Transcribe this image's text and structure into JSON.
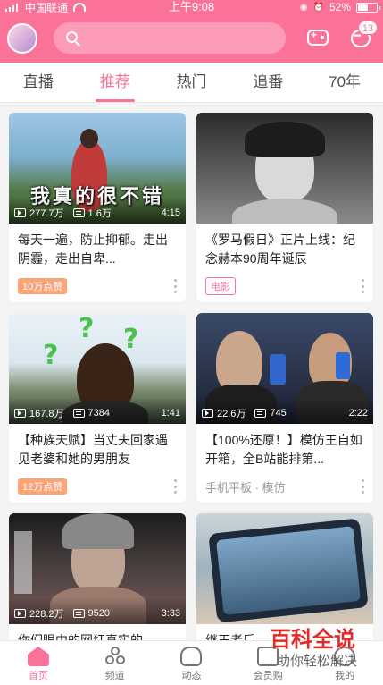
{
  "status_bar": {
    "carrier": "中国联通",
    "time": "上午9:08",
    "battery": "52%"
  },
  "header": {
    "search_placeholder": "",
    "message_badge": "13"
  },
  "tabs": [
    {
      "label": "直播",
      "active": false
    },
    {
      "label": "推荐",
      "active": true
    },
    {
      "label": "热门",
      "active": false
    },
    {
      "label": "追番",
      "active": false
    },
    {
      "label": "70年",
      "active": false
    }
  ],
  "cards": [
    {
      "overlay": "我真的很不错",
      "views": "277.7万",
      "danmaku": "1.6万",
      "duration": "4:15",
      "title": "每天一遍，防止抑郁。走出阴霾，走出自卑...",
      "tag": "10万点赞",
      "tag_style": "fill",
      "meta": ""
    },
    {
      "overlay": "",
      "views": "",
      "danmaku": "",
      "duration": "",
      "title": "《罗马假日》正片上线：纪念赫本90周年诞辰",
      "tag": "电影",
      "tag_style": "line",
      "meta": ""
    },
    {
      "overlay": "",
      "views": "167.8万",
      "danmaku": "7384",
      "duration": "1:41",
      "title": "【种族天赋】当丈夫回家遇见老婆和她的男朋友",
      "tag": "12万点赞",
      "tag_style": "fill",
      "meta": ""
    },
    {
      "overlay": "",
      "views": "22.6万",
      "danmaku": "745",
      "duration": "2:22",
      "title": "【100%还原！】模仿王自如开箱，全B站能排第...",
      "tag": "",
      "tag_style": "",
      "meta": "手机平板 · 模仿"
    },
    {
      "overlay": "",
      "views": "228.2万",
      "danmaku": "9520",
      "duration": "3:33",
      "title": "你们眼中的网红真实的...",
      "tag": "",
      "tag_style": "",
      "meta": ""
    },
    {
      "overlay": "",
      "views": "",
      "danmaku": "",
      "duration": "",
      "title": "继王者后...",
      "tag": "",
      "tag_style": "",
      "meta": ""
    }
  ],
  "bottom_nav": [
    {
      "label": "首页",
      "icon": "home-icon",
      "active": true
    },
    {
      "label": "频道",
      "icon": "channel-icon",
      "active": false
    },
    {
      "label": "动态",
      "icon": "dynamic-icon",
      "active": false
    },
    {
      "label": "会员购",
      "icon": "vip-shop-icon",
      "active": false
    },
    {
      "label": "我的",
      "icon": "profile-icon",
      "active": false
    }
  ],
  "watermark": {
    "main": "百科全说",
    "sub": "助你轻松解决"
  },
  "colors": {
    "brand_pink": "#fb7299",
    "tag_orange": "#fca478"
  }
}
